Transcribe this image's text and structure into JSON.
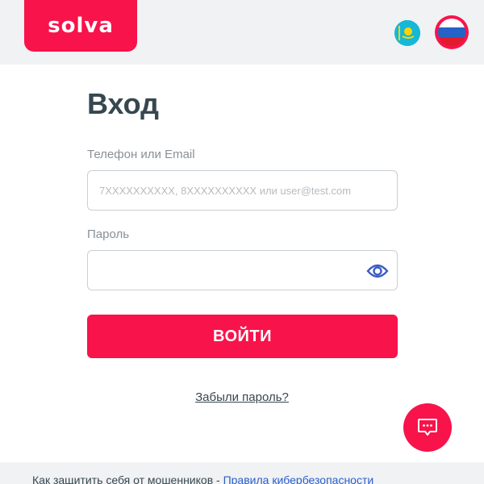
{
  "brand": {
    "logo_text": "solva",
    "accent_color": "#f8134b"
  },
  "header": {
    "languages": [
      {
        "code": "kz",
        "icon": "kazakhstan-flag-icon",
        "colors": [
          "#16b8d7",
          "#ffd400"
        ]
      },
      {
        "code": "ru",
        "icon": "russia-flag-icon",
        "active": true,
        "colors": [
          "#ffffff",
          "#2563c7",
          "#e01b2c"
        ]
      }
    ]
  },
  "login": {
    "title": "Вход",
    "phone_label": "Телефон или Email",
    "phone_placeholder": "7XXXXXXXXXX, 8XXXXXXXXXX или user@test.com",
    "phone_value": "",
    "password_label": "Пароль",
    "password_value": "",
    "show_password_icon": "eye-icon",
    "submit_label": "ВОЙТИ",
    "forgot_label": "Забыли пароль?"
  },
  "chat": {
    "icon": "chat-bubble-icon"
  },
  "footer": {
    "text": "Как защитить себя от мошенников - ",
    "link_label": "Правила кибербезопасности"
  }
}
